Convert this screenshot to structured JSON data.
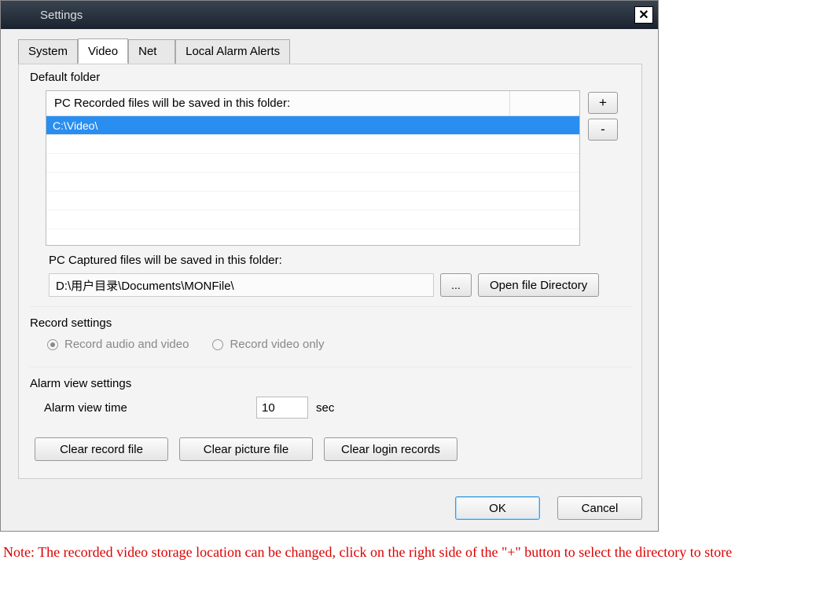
{
  "window": {
    "title": "Settings"
  },
  "tabs": {
    "system": "System",
    "video": "Video",
    "net": "Net",
    "local_alarm": "Local Alarm Alerts"
  },
  "default_folder": {
    "title": "Default folder",
    "grid_header": "PC Recorded files will be saved in this folder:",
    "rows": [
      "C:\\Video\\"
    ],
    "add_label": "+",
    "remove_label": "-"
  },
  "capture": {
    "label": "PC Captured files will be saved in this folder:",
    "path": "D:\\用户目录\\Documents\\MONFile\\",
    "browse": "...",
    "open_dir": "Open file Directory"
  },
  "record_settings": {
    "title": "Record settings",
    "opt_av": "Record audio and video",
    "opt_v": "Record video only"
  },
  "alarm_settings": {
    "title": "Alarm view settings",
    "label": "Alarm view time",
    "value": "10",
    "unit": "sec"
  },
  "buttons": {
    "clear_record": "Clear record file",
    "clear_picture": "Clear picture file",
    "clear_login": "Clear login records",
    "ok": "OK",
    "cancel": "Cancel"
  },
  "note": "Note: The recorded video storage location can be changed, click on the right side of the \"+\" button to select the directory to store"
}
